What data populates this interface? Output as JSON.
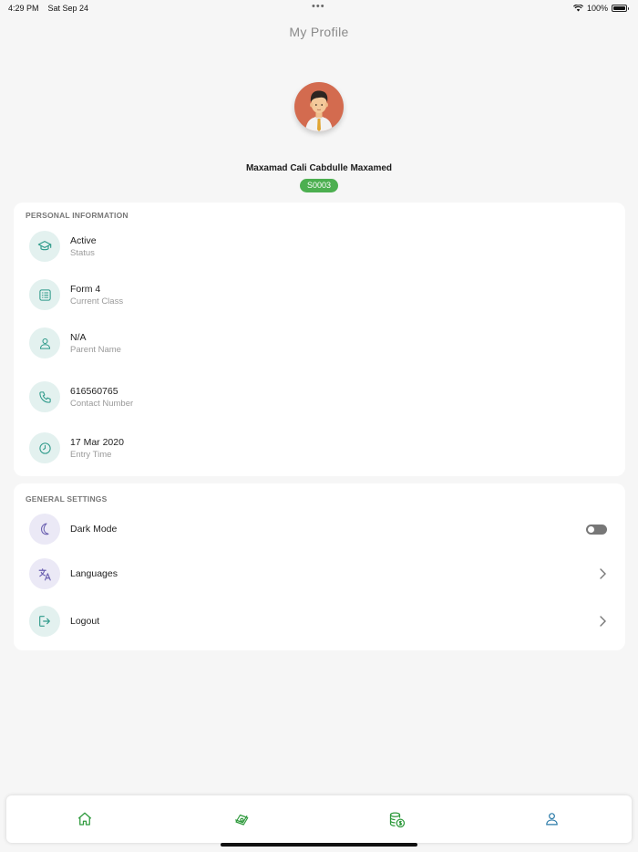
{
  "status_bar": {
    "time": "4:29 PM",
    "date": "Sat Sep 24",
    "battery": "100%",
    "icons": [
      "wifi-icon",
      "battery-icon"
    ]
  },
  "header": {
    "title": "My Profile"
  },
  "profile": {
    "name": "Maxamad Cali Cabdulle Maxamed",
    "student_id": "S0003"
  },
  "personal_info": {
    "title": "PERSONAL INFORMATION",
    "items": [
      {
        "value": "Active",
        "label": "Status",
        "icon": "graduation-cap-icon"
      },
      {
        "value": "Form 4",
        "label": "Current Class",
        "icon": "class-list-icon"
      },
      {
        "value": "N/A",
        "label": "Parent Name",
        "icon": "person-icon"
      },
      {
        "value": "616560765",
        "label": "Contact Number",
        "icon": "phone-icon"
      },
      {
        "value": "17 Mar 2020",
        "label": "Entry Time",
        "icon": "clock-icon"
      }
    ]
  },
  "general_settings": {
    "title": "GENERAL SETTINGS",
    "items": [
      {
        "label": "Dark Mode",
        "icon": "moon-icon",
        "control": "toggle",
        "enabled": false
      },
      {
        "label": "Languages",
        "icon": "translate-icon",
        "control": "chevron"
      },
      {
        "label": "Logout",
        "icon": "logout-icon",
        "control": "chevron"
      }
    ]
  },
  "tab_bar": {
    "tabs": [
      {
        "icon": "home-icon",
        "active": false
      },
      {
        "icon": "money-icon",
        "active": false
      },
      {
        "icon": "coins-icon",
        "active": false
      },
      {
        "icon": "profile-icon",
        "active": true
      }
    ]
  },
  "colors": {
    "accent_green": "#4caf50",
    "teal_icon": "#2e9a8a",
    "purple_icon": "#6a5fb0",
    "tab_green": "#2f9a3d",
    "tab_profile_blue": "#2a7aa8"
  }
}
